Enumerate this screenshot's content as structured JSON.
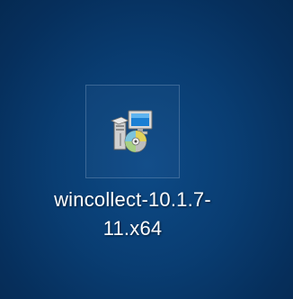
{
  "desktop": {
    "shortcut": {
      "icon": "installer-setup-icon",
      "name_line1": "wincollect-10.1.7-",
      "name_line2": "11.x64"
    }
  }
}
